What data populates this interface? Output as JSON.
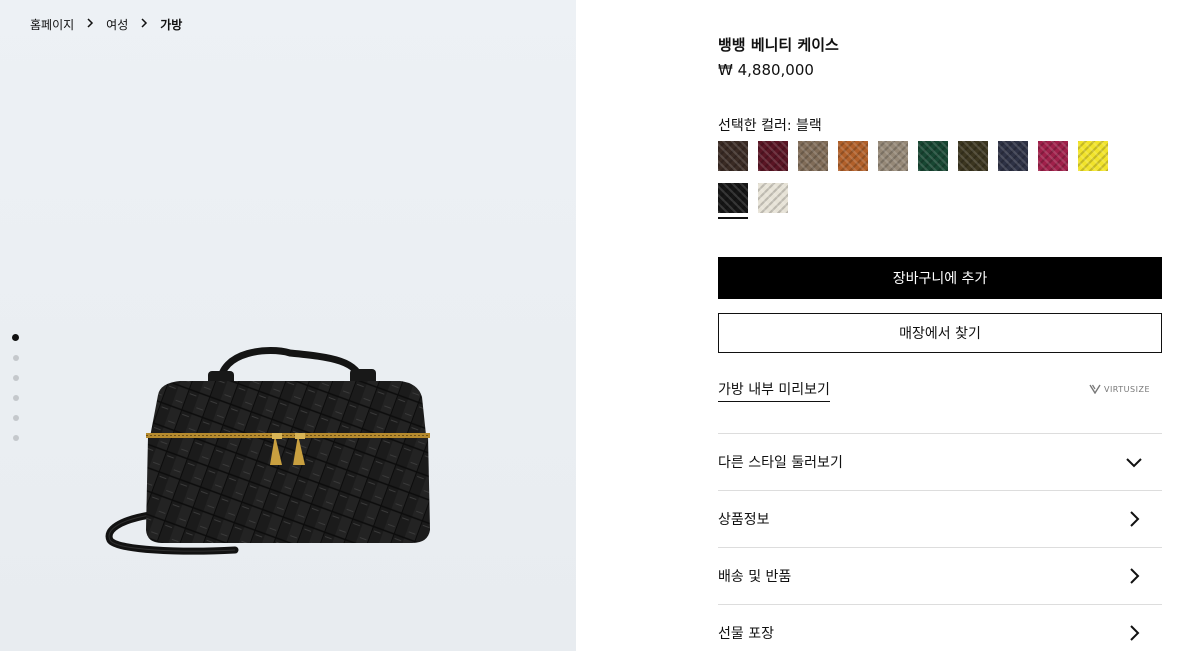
{
  "breadcrumb": {
    "items": [
      "홈페이지",
      "여성",
      "가방"
    ]
  },
  "gallery": {
    "dots_count": 6,
    "active_index": 0
  },
  "product": {
    "title": "뱅뱅 베니티 케이스",
    "price": "₩ 4,880,000",
    "color_label": "선택한 컬러: 블랙",
    "swatches": [
      {
        "name": "dark-brown",
        "color": "#3a2b24"
      },
      {
        "name": "burgundy",
        "color": "#5a1524"
      },
      {
        "name": "taupe",
        "color": "#806c58"
      },
      {
        "name": "caramel",
        "color": "#b1602a"
      },
      {
        "name": "greige",
        "color": "#958877"
      },
      {
        "name": "green",
        "color": "#184733"
      },
      {
        "name": "olive-brown",
        "color": "#3c3620"
      },
      {
        "name": "navy",
        "color": "#2e3245"
      },
      {
        "name": "raspberry",
        "color": "#a0204a"
      },
      {
        "name": "yellow",
        "color": "#f1e32a"
      },
      {
        "name": "black",
        "color": "#161616",
        "selected": true
      },
      {
        "name": "cream",
        "color": "#e6e2d6"
      }
    ]
  },
  "actions": {
    "add_to_cart": "장바구니에 추가",
    "find_in_store": "매장에서 찾기"
  },
  "preview": {
    "link_label": "가방 내부 미리보기",
    "virtusize_label": "VIRTUSIZE"
  },
  "accordion": [
    {
      "label": "다른 스타일 둘러보기",
      "icon": "chevron-down-icon"
    },
    {
      "label": "상품정보",
      "icon": "chevron-right-icon"
    },
    {
      "label": "배송 및 반품",
      "icon": "chevron-right-icon"
    },
    {
      "label": "선물 포장",
      "icon": "chevron-right-icon"
    }
  ]
}
